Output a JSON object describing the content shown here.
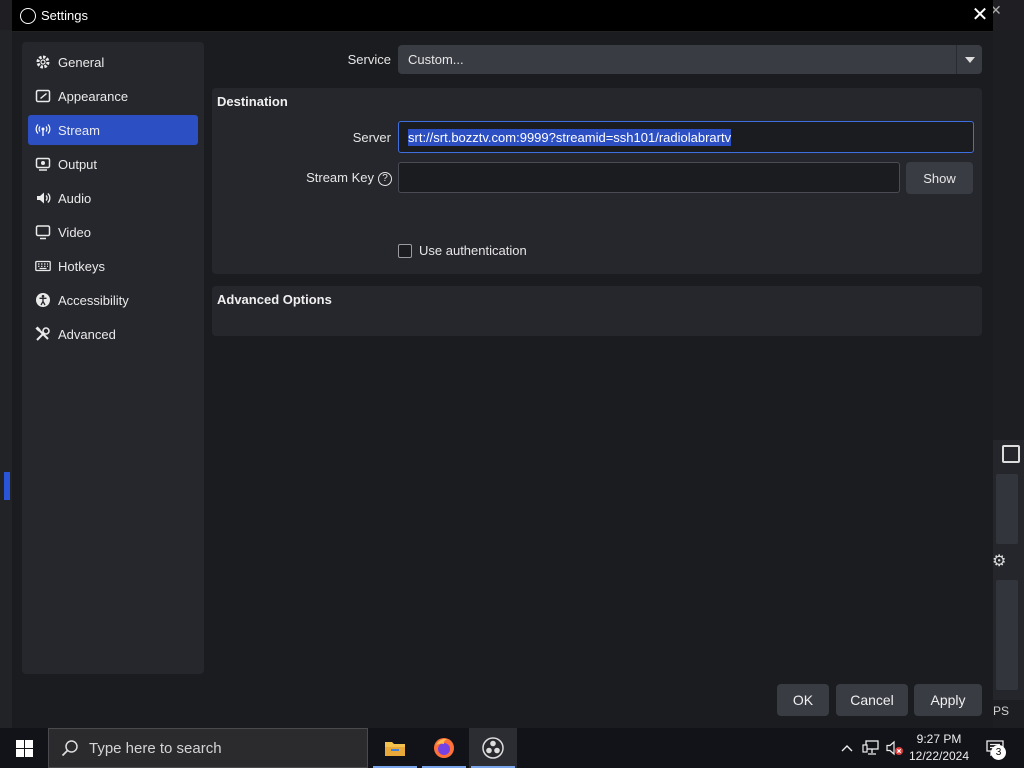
{
  "dialog": {
    "title": "Settings"
  },
  "sidebar": {
    "items": [
      {
        "label": "General",
        "icon": "gear-icon"
      },
      {
        "label": "Appearance",
        "icon": "appearance-icon"
      },
      {
        "label": "Stream",
        "icon": "broadcast-icon",
        "active": true
      },
      {
        "label": "Output",
        "icon": "output-icon"
      },
      {
        "label": "Audio",
        "icon": "speaker-icon"
      },
      {
        "label": "Video",
        "icon": "monitor-icon"
      },
      {
        "label": "Hotkeys",
        "icon": "keyboard-icon"
      },
      {
        "label": "Accessibility",
        "icon": "accessibility-icon"
      },
      {
        "label": "Advanced",
        "icon": "tools-icon"
      }
    ]
  },
  "stream": {
    "service_label": "Service",
    "service_value": "Custom...",
    "destination_title": "Destination",
    "server_label": "Server",
    "server_value": "srt://srt.bozztv.com:9999?streamid=ssh101/radiolabrartv",
    "stream_key_label": "Stream Key",
    "stream_key_value": "",
    "help_glyph": "?",
    "show_label": "Show",
    "use_auth_label": "Use authentication",
    "use_auth_checked": false,
    "advanced_title": "Advanced Options"
  },
  "buttons": {
    "ok": "OK",
    "cancel": "Cancel",
    "apply": "Apply"
  },
  "background": {
    "fps_fragment": "PS"
  },
  "taskbar": {
    "search_placeholder": "Type here to search",
    "time": "9:27 PM",
    "date": "12/22/2024",
    "notification_count": "3",
    "apps": [
      "file-explorer-icon",
      "firefox-icon",
      "obs-icon"
    ]
  },
  "colors": {
    "accent": "#2d4fc4",
    "dialog_bg": "#1b1c20",
    "panel_bg": "#26272c",
    "button_bg": "#3a3c44"
  }
}
